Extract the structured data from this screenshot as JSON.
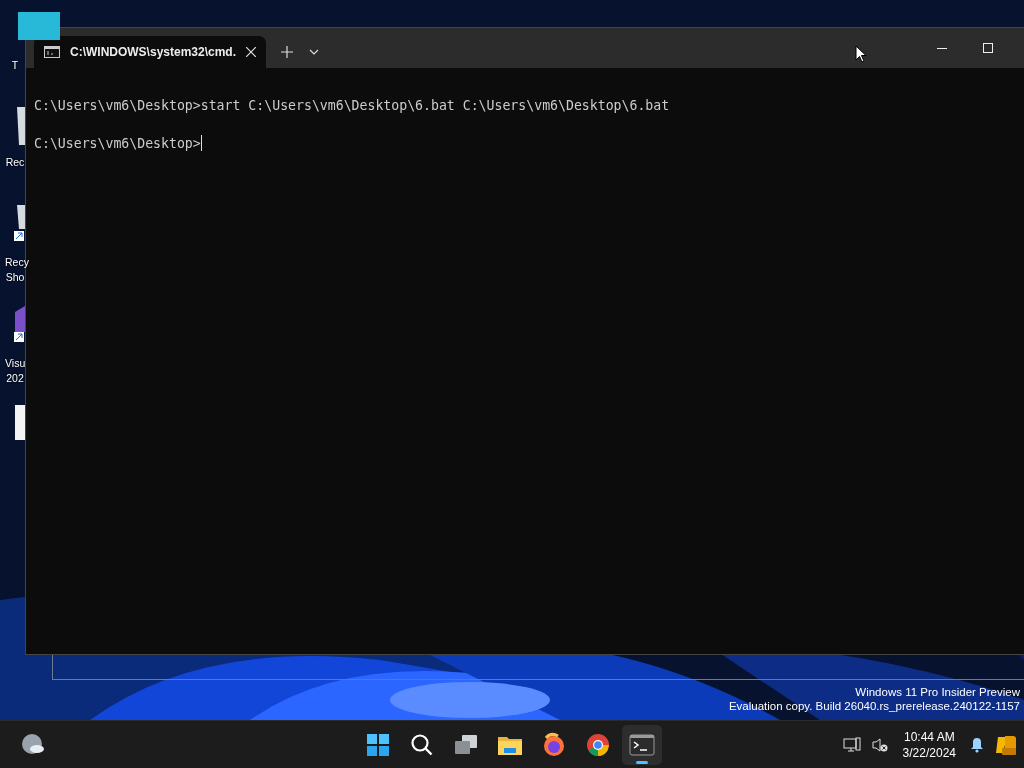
{
  "desktop": {
    "icons": [
      {
        "kind": "tile",
        "label_lines": [
          "T"
        ]
      },
      {
        "kind": "bin",
        "label_lines": [
          "Rec"
        ]
      },
      {
        "kind": "bin_shortcut",
        "label_lines": [
          "Recy",
          "Sho"
        ]
      },
      {
        "kind": "vs_shortcut",
        "label_lines": [
          "Visu",
          "202"
        ]
      },
      {
        "kind": "file"
      }
    ],
    "watermark": [
      "Windows 11 Pro Insider Preview",
      "Evaluation copy. Build 26040.rs_prerelease.240122-1157"
    ]
  },
  "window": {
    "tabs": [
      {
        "title": "C:\\WINDOWS\\system32\\cmd.",
        "selected": true
      }
    ],
    "console": {
      "lines": [
        "C:\\Users\\vm6\\Desktop>start C:\\Users\\vm6\\Desktop\\6.bat C:\\Users\\vm6\\Desktop\\6.bat",
        "C:\\Users\\vm6\\Desktop>"
      ],
      "cursor": true
    }
  },
  "taskbar": {
    "apps": [
      {
        "kind": "start",
        "active": false
      },
      {
        "kind": "search",
        "active": false
      },
      {
        "kind": "taskview",
        "active": false
      },
      {
        "kind": "explorer",
        "active": false
      },
      {
        "kind": "firefox",
        "active": false
      },
      {
        "kind": "chrome",
        "active": false
      },
      {
        "kind": "terminal",
        "active": true
      }
    ],
    "time": "10:44 AM",
    "date": "3/22/2024"
  }
}
